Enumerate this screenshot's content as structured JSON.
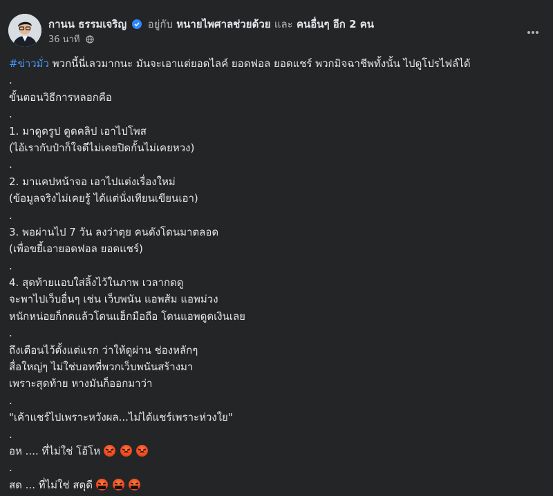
{
  "post": {
    "author": "กานน ธรรมเจริญ",
    "with_text": "อยู่กับ",
    "tagged_page": "หนายไพศาลช่วยด้วย",
    "and_text": "และ",
    "others": "คนอื่นๆ อีก 2 คน",
    "time": "36 นาที",
    "privacy_icon": "globe-icon",
    "more_icon": "more-options-icon"
  },
  "content": {
    "hashtag": "#ข่าวมั่ว",
    "line1_rest": " พวกนี้นี่เลวมากนะ มันจะเอาแต่ยอดไลค์ ยอดฟอล ยอดแชร์ พวกมิจฉาชีพทั้งนั้น ไปดูโปรไฟล์ได้",
    "lines": [
      ".",
      "ขั้นตอนวิธีการหลอกคือ",
      ".",
      "1. มาดูดรูป ดูดคลิป เอาไปโพส",
      "(ไอ้เรากับป๋าก็ใจดีไม่เคยปิดกั้นไม่เคยหวง)",
      ".",
      "2. มาแคปหน้าจอ เอาไปแต่งเรื่องใหม่",
      "(ข้อมูลจริงไม่เคยรู้ ได้แต่นั่งเทียนเขียนเอา)",
      ".",
      "3. พอผ่านไป 7 วัน ลงว่าตุย คนดังโดนมาตลอด",
      "(เพื่อขยี้เอายอดฟอล ยอดแชร์)",
      ".",
      "4. สุดท้ายแอบใส่ลิ้งไว้ในภาพ เวลากดดู",
      "จะพาไปเว็บอื่นๆ เช่น เว็บพนัน แอพส้ม แอพม่วง",
      "หนักหน่อยก็กดแล้วโดนแฮ็กมือถือ โดนแอพดูดเงินเลย",
      ".",
      "ถึงเตือนไว้ตั้งแต่แรก ว่าให้ดูผ่าน ช่องหลักๆ",
      "สื่อใหญ่ๆ ไม่ใช่บอทที่พวกเว็บพนันสร้างมา",
      "เพราะสุดท้าย หางมันก็ออกมาว่า",
      ".",
      "\"เค้าแชร์ไปเพราะหวังผล...ไม่ได้แชร์เพราะห่วงใย\"",
      "."
    ],
    "line_ah": "อห .... ที่ไม่ใช่ โอ้โห ",
    "dot_after_ah": ".",
    "line_sot": "สด ... ที่ไม่ใช่ สดุดี ",
    "emoji_angry": "angry-face-emoji",
    "emoji_cursing": "cursing-face-emoji"
  }
}
